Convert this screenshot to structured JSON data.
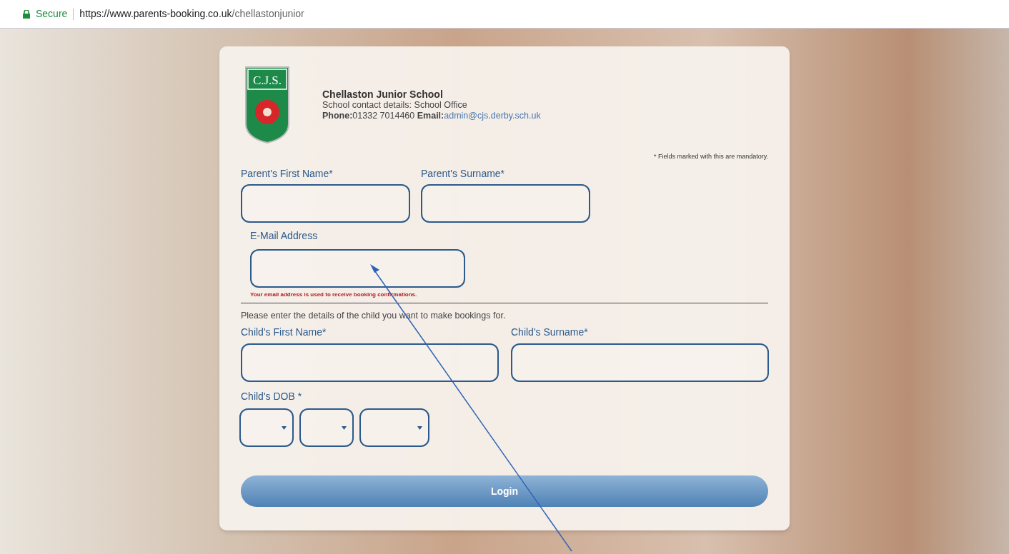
{
  "browser": {
    "security": "Secure",
    "url_host": "https://www.parents-booking.co.uk",
    "url_path": "/chellastonjunior"
  },
  "school": {
    "logo_text": "C.J.S.",
    "name": "Chellaston Junior School",
    "contact": "School contact details: School Office",
    "phone_line": "**Phone:**01332 7014460 **Email:**",
    "email": "admin@cjs.derby.sch.uk"
  },
  "mandatory_note": "* Fields marked with this are mandatory.",
  "parent_fields": [
    {
      "label": "Parent's First Name*"
    },
    {
      "label": "Parent's Surname*"
    }
  ],
  "email_field": {
    "label": "E-Mail Address",
    "hint": "Your email address is used to receive booking confirmations."
  },
  "child_intro": "Please enter the details of the child you want to make bookings for.",
  "child_fields": [
    {
      "label": "Child's First Name*"
    },
    {
      "label": "Child's Surname*"
    }
  ],
  "dob": {
    "label": "Child's DOB *",
    "selects": [
      {
        "kind": "day"
      },
      {
        "kind": "month"
      },
      {
        "kind": "year"
      }
    ]
  },
  "login_button": "Login"
}
